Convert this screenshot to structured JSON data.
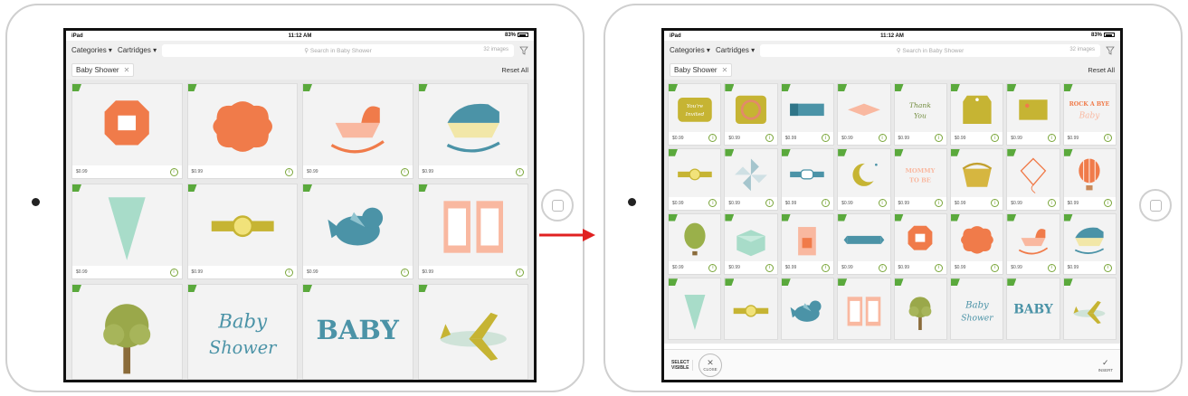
{
  "left": {
    "status": {
      "device": "iPad",
      "time": "11:12 AM",
      "battery": "83%"
    },
    "nav": {
      "categories": "Categories ▾",
      "cartridges": "Cartridges ▾",
      "search_placeholder": "Search in Baby Shower",
      "count": "32 images"
    },
    "filter": {
      "chip": "Baby Shower",
      "reset": "Reset All"
    },
    "tiles": [
      {
        "art": "box",
        "price": "$0.99"
      },
      {
        "art": "label-orange",
        "price": "$0.99"
      },
      {
        "art": "cradle-orange",
        "price": "$0.99"
      },
      {
        "art": "cradle-blue",
        "price": "$0.99"
      },
      {
        "art": "cone",
        "price": "$0.99"
      },
      {
        "art": "band",
        "price": "$0.99"
      },
      {
        "art": "bird",
        "price": "$0.99"
      },
      {
        "art": "frames",
        "price": "$0.99"
      },
      {
        "art": "tree",
        "price": ""
      },
      {
        "art": "baby-shower-text",
        "price": "",
        "text": "Baby Shower"
      },
      {
        "art": "baby-text",
        "price": "",
        "text": "BABY"
      },
      {
        "art": "plane",
        "price": ""
      }
    ]
  },
  "right": {
    "status": {
      "device": "iPad",
      "time": "11:12 AM",
      "battery": "83%"
    },
    "nav": {
      "categories": "Categories ▾",
      "cartridges": "Cartridges ▾",
      "search_placeholder": "Search in Baby Shower",
      "count": "32 images"
    },
    "filter": {
      "chip": "Baby Shower",
      "reset": "Reset All"
    },
    "tiles": [
      {
        "art": "youre-invited",
        "price": "$0.99",
        "text": "You're Invited"
      },
      {
        "art": "wreath",
        "price": "$0.99"
      },
      {
        "art": "ribbon-blue",
        "price": "$0.99"
      },
      {
        "art": "diamond",
        "price": "$0.99"
      },
      {
        "art": "thank-you",
        "price": "$0.99",
        "text": "Thank You"
      },
      {
        "art": "tag-gold",
        "price": "$0.99"
      },
      {
        "art": "gold-label",
        "price": "$0.99"
      },
      {
        "art": "rock-a-bye",
        "price": "$0.99",
        "text": "ROCK A BYE Baby"
      },
      {
        "art": "band",
        "price": "$0.99"
      },
      {
        "art": "pinwheel",
        "price": "$0.99"
      },
      {
        "art": "band-blue",
        "price": "$0.99"
      },
      {
        "art": "moon",
        "price": "$0.99"
      },
      {
        "art": "mommy",
        "price": "$0.99",
        "text": "MOMMY TO BE"
      },
      {
        "art": "basket",
        "price": "$0.99"
      },
      {
        "art": "kite",
        "price": "$0.99"
      },
      {
        "art": "balloon",
        "price": "$0.99"
      },
      {
        "art": "hot-air-balloon-green",
        "price": "$0.99"
      },
      {
        "art": "box-mint",
        "price": "$0.99"
      },
      {
        "art": "bag",
        "price": "$0.99"
      },
      {
        "art": "ribbon-teal",
        "price": "$0.99"
      },
      {
        "art": "box",
        "price": "$0.99"
      },
      {
        "art": "label-orange",
        "price": "$0.99"
      },
      {
        "art": "cradle-orange",
        "price": "$0.99"
      },
      {
        "art": "cradle-blue",
        "price": "$0.99"
      },
      {
        "art": "cone",
        "price": ""
      },
      {
        "art": "band",
        "price": ""
      },
      {
        "art": "bird",
        "price": ""
      },
      {
        "art": "frames",
        "price": ""
      },
      {
        "art": "tree",
        "price": ""
      },
      {
        "art": "baby-shower-text",
        "price": "",
        "text": "Baby Shower"
      },
      {
        "art": "baby-text",
        "price": "",
        "text": "BABY"
      },
      {
        "art": "plane",
        "price": ""
      }
    ],
    "bottom": {
      "select_visible": "SELECT VISIBLE",
      "close": "CLOSE",
      "insert": "INSERT"
    }
  },
  "colors": {
    "orange": "#f07b4a",
    "teal": "#4b93a7",
    "gold": "#c6b433",
    "mint": "#a8dcc9",
    "peach": "#f9b8a0",
    "green_badge": "#5aa93c",
    "arrow": "#e02020"
  }
}
